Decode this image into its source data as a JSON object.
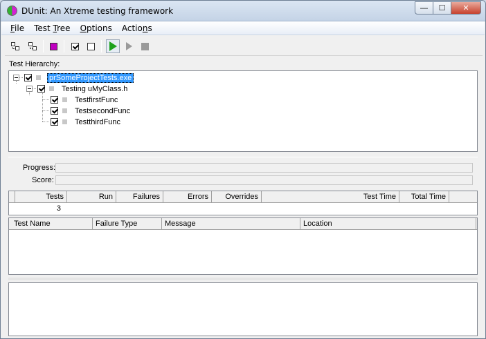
{
  "window": {
    "title": "DUnit: An Xtreme testing framework",
    "caption_buttons": {
      "minimize": "—",
      "maximize": "☐",
      "close": "✕"
    }
  },
  "menu": [
    {
      "label": "File",
      "underline": "F",
      "rest": "ile"
    },
    {
      "label": "Test Tree",
      "prefix": "Test ",
      "underline": "T",
      "rest": "ree"
    },
    {
      "label": "Options",
      "underline": "O",
      "rest": "ptions"
    },
    {
      "label": "Actions",
      "prefix": "Actio",
      "underline": "n",
      "rest": "s"
    }
  ],
  "toolbar": {
    "buttons": [
      "select-all-icon",
      "deselect-all-icon",
      "select-failed-icon",
      "check-icon",
      "uncheck-icon",
      "run-icon",
      "run-selected-icon",
      "stop-icon"
    ]
  },
  "hierarchy": {
    "label": "Test Hierarchy:",
    "nodes": [
      {
        "text": "prSomeProjectTests.exe",
        "checked": true,
        "selected": true
      },
      {
        "text": "Testing uMyClass.h",
        "checked": true,
        "selected": false
      },
      {
        "text": "TestfirstFunc",
        "checked": true,
        "selected": false
      },
      {
        "text": "TestsecondFunc",
        "checked": true,
        "selected": false
      },
      {
        "text": "TestthirdFunc",
        "checked": true,
        "selected": false
      }
    ]
  },
  "progress": {
    "label": "Progress:",
    "value": 0
  },
  "score": {
    "label": "Score:",
    "value": 0
  },
  "stats": {
    "headers": [
      "Tests",
      "Run",
      "Failures",
      "Errors",
      "Overrides",
      "Test Time",
      "Total Time"
    ],
    "values": [
      "3",
      "",
      "",
      "",
      "",
      "",
      ""
    ]
  },
  "failures": {
    "headers": [
      "Test Name",
      "Failure Type",
      "Message",
      "Location"
    ]
  },
  "colors": {
    "selection": "#3399ff",
    "run_button": "#1ea21e",
    "node_state": "#c8c8c8"
  }
}
